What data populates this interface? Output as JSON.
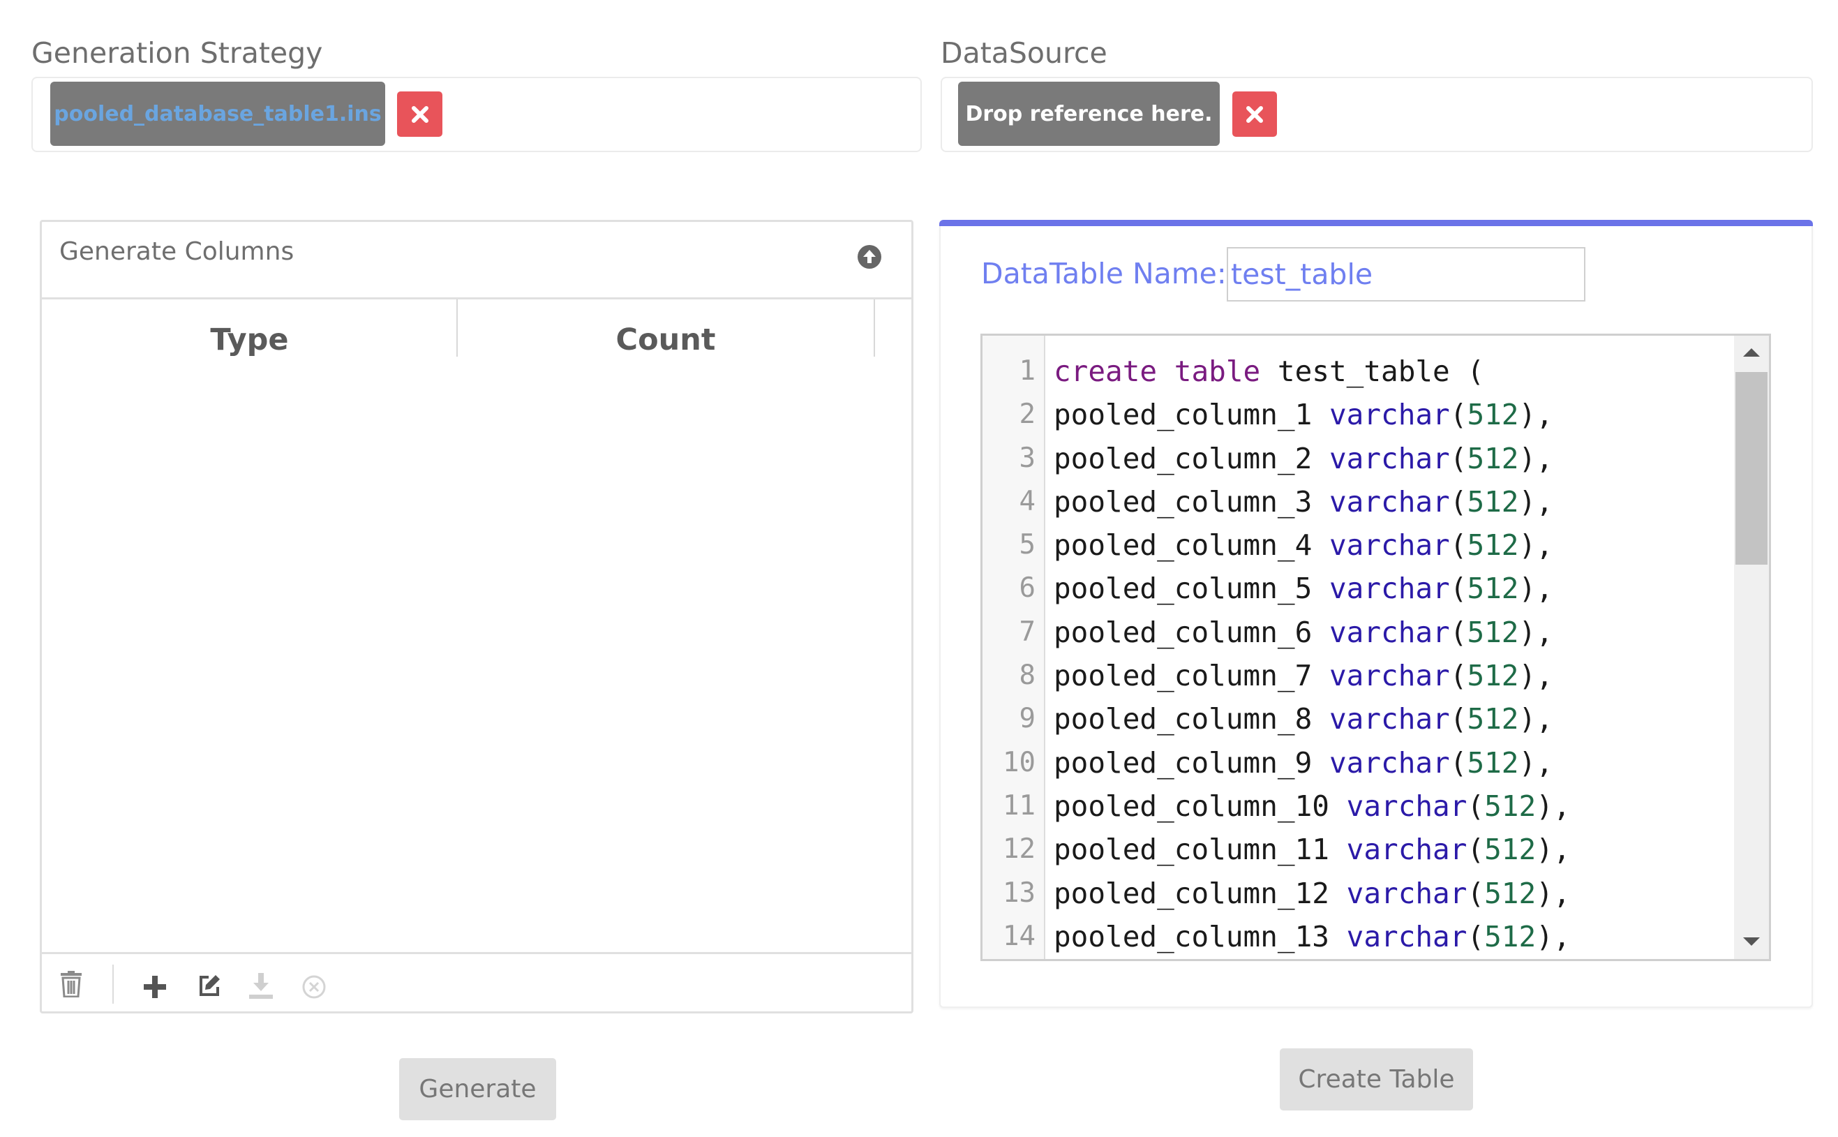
{
  "generation_strategy": {
    "label": "Generation Strategy",
    "reference": "pooled_database_table1.ins",
    "remove_icon": "close-icon"
  },
  "datasource": {
    "label": "DataSource",
    "placeholder": "Drop reference here.",
    "remove_icon": "close-icon"
  },
  "columns_panel": {
    "title": "Generate Columns",
    "collapse_icon": "arrow-up-circle-icon",
    "headers": [
      "Type",
      "Count"
    ],
    "rows": [],
    "toolbar": [
      "trash-icon",
      "plus-icon",
      "edit-icon",
      "download-icon",
      "cancel-circle-icon"
    ],
    "generate_button": "Generate"
  },
  "datatable": {
    "name_label": "DataTable Name:",
    "name_value": "test_table",
    "create_button": "Create Table",
    "accent_color": "#6b73e8",
    "sql_lines": [
      "create table test_table (",
      "pooled_column_1 varchar(512),",
      "pooled_column_2 varchar(512),",
      "pooled_column_3 varchar(512),",
      "pooled_column_4 varchar(512),",
      "pooled_column_5 varchar(512),",
      "pooled_column_6 varchar(512),",
      "pooled_column_7 varchar(512),",
      "pooled_column_8 varchar(512),",
      "pooled_column_9 varchar(512),",
      "pooled_column_10 varchar(512),",
      "pooled_column_11 varchar(512),",
      "pooled_column_12 varchar(512),",
      "pooled_column_13 varchar(512),"
    ]
  },
  "colors": {
    "remove_button": "#e8545a",
    "chip_background": "#7a7a7a",
    "keyword": "#7a1b80",
    "type": "#2b1aa8",
    "number": "#1e6b47"
  }
}
